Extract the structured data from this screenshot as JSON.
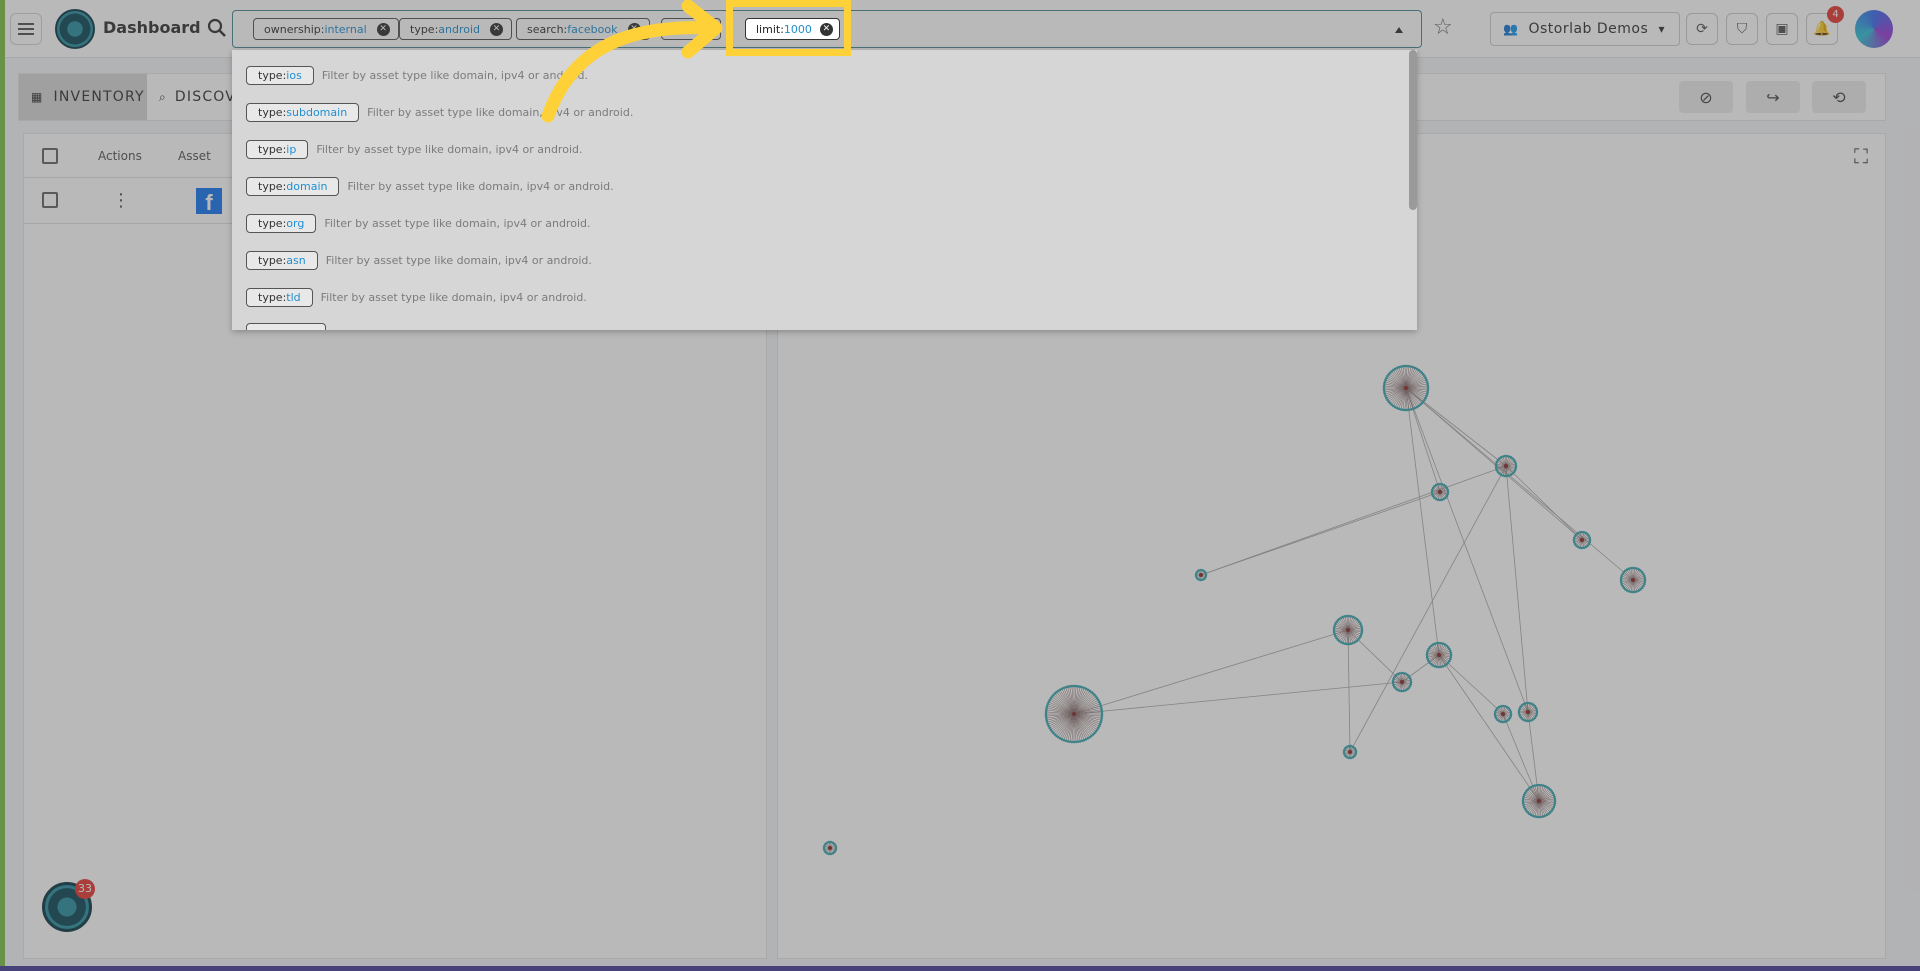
{
  "app": {
    "title": "Dashboard"
  },
  "search": {
    "chips": [
      {
        "key": "ownership:",
        "value": "internal"
      },
      {
        "key": "type:",
        "value": "android"
      },
      {
        "key": "search:",
        "value": "facebook"
      },
      {
        "key": "",
        "value": ""
      }
    ],
    "highlighted_chip": {
      "key": "limit:",
      "value": "1000"
    }
  },
  "dropdown": {
    "items": [
      {
        "key": "type:",
        "value": "ios",
        "description": "Filter by asset type like domain, ipv4 or android."
      },
      {
        "key": "type:",
        "value": "subdomain",
        "description": "Filter by asset type like domain, ipv4 or android."
      },
      {
        "key": "type:",
        "value": "ip",
        "description": "Filter by asset type like domain, ipv4 or android."
      },
      {
        "key": "type:",
        "value": "domain",
        "description": "Filter by asset type like domain, ipv4 or android."
      },
      {
        "key": "type:",
        "value": "org",
        "description": "Filter by asset type like domain, ipv4 or android."
      },
      {
        "key": "type:",
        "value": "asn",
        "description": "Filter by asset type like domain, ipv4 or android."
      },
      {
        "key": "type:",
        "value": "tld",
        "description": "Filter by asset type like domain, ipv4 or android."
      }
    ]
  },
  "header": {
    "org_name": "Ostorlab Demos",
    "notification_count": "4"
  },
  "tabs": [
    {
      "label": "INVENTORY"
    },
    {
      "label": "DISCOV"
    }
  ],
  "table": {
    "headers": {
      "actions": "Actions",
      "asset": "Asset"
    },
    "rows": [
      {
        "icon": "f"
      }
    ]
  },
  "fab": {
    "badge": "33"
  },
  "colors": {
    "highlight": "#ffd138",
    "accent": "#1f8fd1",
    "facebook": "#1877f2"
  }
}
